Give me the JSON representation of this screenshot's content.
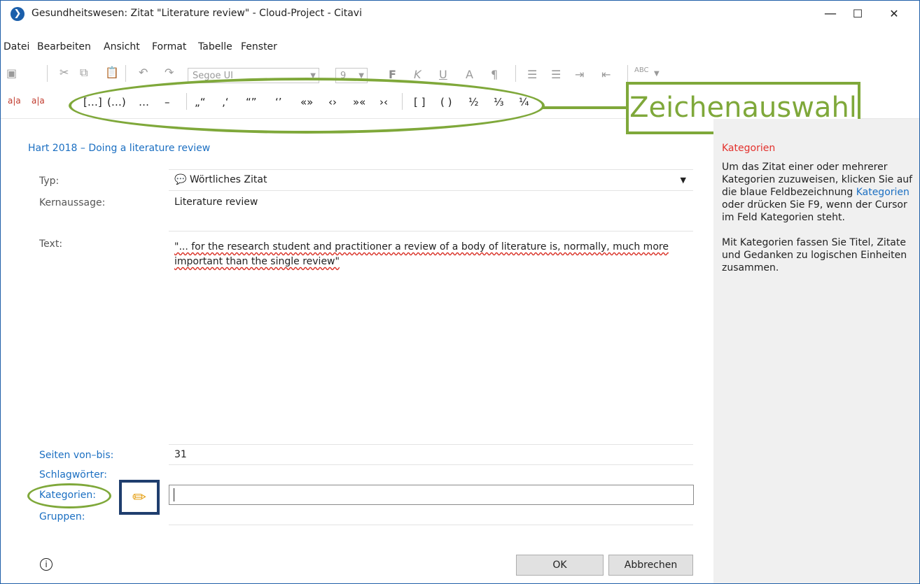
{
  "window": {
    "title": "Gesundheitswesen: Zitat \"Literature review\" - Cloud-Project - Citavi",
    "logo_glyph": "❯",
    "minimize": "—",
    "maximize": "☐",
    "close": "✕"
  },
  "menu": [
    "Datei",
    "Bearbeiten",
    "Ansicht",
    "Format",
    "Tabelle",
    "Fenster"
  ],
  "toolbar": {
    "font_name": "Segoe UI",
    "font_size": "9",
    "bold": "F",
    "italic": "K",
    "underline": "U",
    "font_color": "A",
    "spellcheck": "ABC"
  },
  "char_toolbar": {
    "items": [
      "a|a",
      "a|a",
      "[…]",
      "(…)",
      "…",
      "–",
      "„“",
      "‚‘",
      "“”",
      "‘’",
      "«»",
      "‹›",
      "»«",
      "›‹",
      "[ ]",
      "( )",
      "½",
      "⅓",
      "¼"
    ]
  },
  "callout": {
    "label": "Zeichenauswahl"
  },
  "form": {
    "reference": "Hart 2018 – Doing a literature review",
    "type_label": "Typ:",
    "type_value": "Wörtliches Zitat",
    "core_label": "Kernaussage:",
    "core_value": "Literature review",
    "text_label": "Text:",
    "text_value": "\"... for the research student and practitioner a review of a body of literature is, normally, much more important than the single review\"",
    "pages_label": "Seiten von–bis:",
    "pages_value": "31",
    "keywords_label": "Schlagwörter:",
    "categories_label": "Kategorien:",
    "groups_label": "Gruppen:"
  },
  "sidebar": {
    "title": "Kategorien",
    "para1_a": "Um das Zitat einer oder mehrerer Kategorien zuzuweisen, klicken Sie auf die blaue Feldbezeichnung ",
    "para1_link": "Kategorien",
    "para1_b": " oder drücken Sie F9, wenn der Cursor im Feld Kategorien steht.",
    "para2": "Mit Kategorien fassen Sie Titel, Zitate und Gedanken zu logischen Einheiten zusammen."
  },
  "buttons": {
    "ok": "OK",
    "cancel": "Abbrechen"
  },
  "colors": {
    "accent_green": "#7fa83a",
    "link_blue": "#1b6fc2",
    "sidebar_title_red": "#e3312d",
    "sidebar_bg": "#f0f0f0"
  }
}
